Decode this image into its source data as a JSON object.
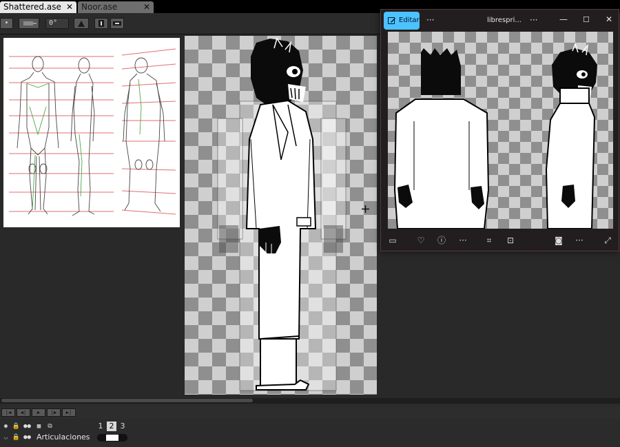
{
  "tabs": [
    {
      "label": "Shattered.ase",
      "close": "✕",
      "active": true
    },
    {
      "label": "Noor.ase",
      "close": "✕",
      "active": false
    }
  ],
  "toolbar": {
    "rotation_value": "0°",
    "tool_icon_names": [
      "dot-icon",
      "pixel-perfect-icon",
      "rotation-icon",
      "pivot-icon",
      "flip-vertical-icon",
      "flip-horizontal-icon"
    ]
  },
  "timeline": {
    "frames": [
      "1",
      "2",
      "3"
    ],
    "layer_name": "Articulaciones"
  },
  "viewer": {
    "edit_label": "Editar",
    "more_label": "···",
    "title": "librespri...",
    "more2_label": "···",
    "window_controls": [
      "minimize-icon",
      "maximize-icon",
      "close-icon"
    ],
    "bottom_icons": [
      "filmstrip-icon",
      "heart-icon",
      "info-icon",
      "more-icon",
      "crop-icon",
      "scan-icon",
      "snapshot-icon",
      "more-icon",
      "expand-icon"
    ]
  },
  "colors": {
    "viewer_accent": "#4cc2ff",
    "viewer_bg": "#221e1f",
    "checker_light": "#cfcfcf",
    "checker_dark": "#8f8f8f"
  }
}
